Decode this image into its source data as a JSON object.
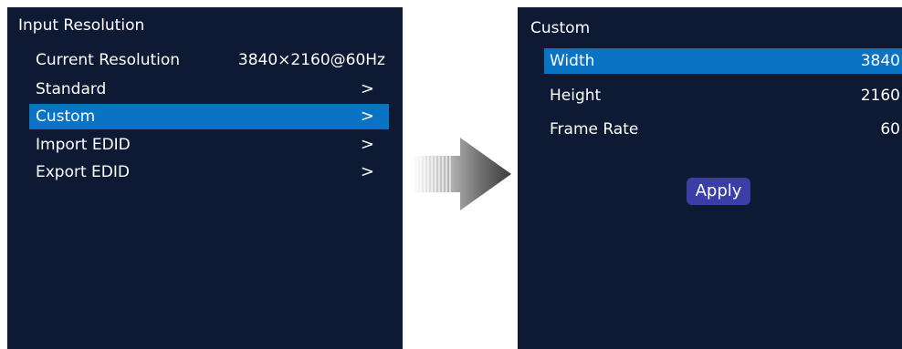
{
  "left_panel": {
    "title": "Input Resolution",
    "items": [
      {
        "label": "Current Resolution",
        "value": "3840×2160@60Hz",
        "chevron": ""
      },
      {
        "label": "Standard",
        "value": "",
        "chevron": ">"
      },
      {
        "label": "Custom",
        "value": "",
        "chevron": ">",
        "selected": true
      },
      {
        "label": "Import EDID",
        "value": "",
        "chevron": ">"
      },
      {
        "label": "Export EDID",
        "value": "",
        "chevron": ">"
      }
    ]
  },
  "right_panel": {
    "title": "Custom",
    "fields": [
      {
        "label": "Width",
        "value": "3840",
        "selected": true
      },
      {
        "label": "Height",
        "value": "2160"
      },
      {
        "label": "Frame Rate",
        "value": "60"
      }
    ],
    "apply_label": "Apply"
  },
  "arrow_icon": "right-arrow-icon",
  "colors": {
    "panel_bg": "#0e1a33",
    "selected_bg": "#0a73c4",
    "button_bg": "#3b3ea6",
    "text": "#ffffff"
  }
}
